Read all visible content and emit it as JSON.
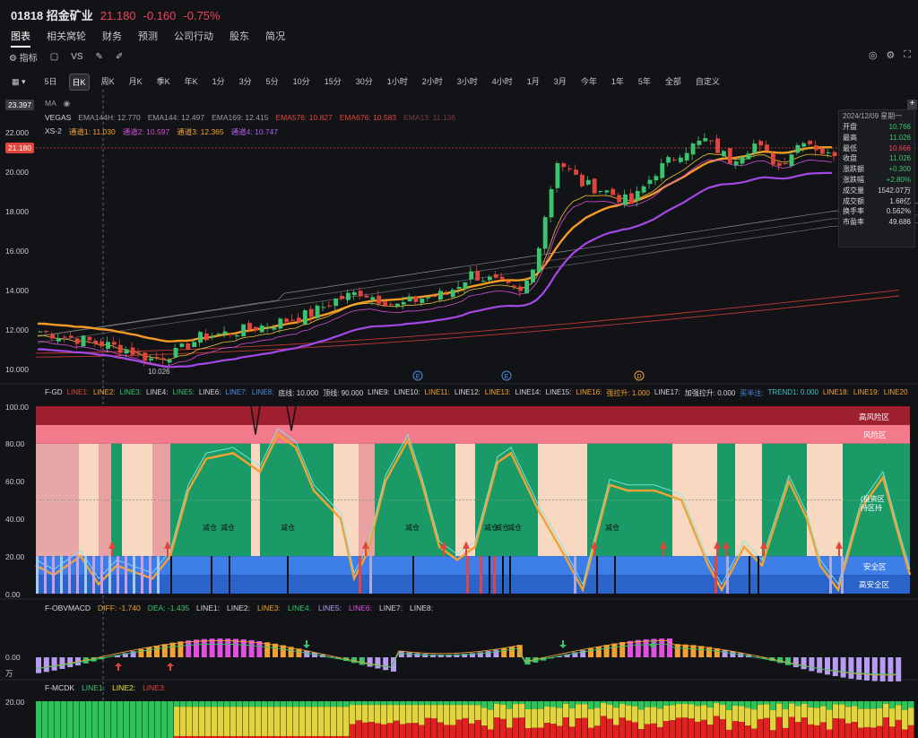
{
  "header": {
    "code": "01818 招金矿业",
    "price": "21.180",
    "change": "-0.160",
    "change_pct": "-0.75%"
  },
  "nav": [
    "图表",
    "相关窝轮",
    "财务",
    "预测",
    "公司行动",
    "股东",
    "简况"
  ],
  "tools": {
    "indicator": "指标",
    "vs": "VS"
  },
  "timeframes": [
    "5日",
    "日K",
    "周K",
    "月K",
    "季K",
    "年K",
    "1分",
    "3分",
    "5分",
    "10分",
    "15分",
    "30分",
    "1小时",
    "2小时",
    "3小时",
    "4小时",
    "1月",
    "3月",
    "今年",
    "1年",
    "5年",
    "全部",
    "自定义"
  ],
  "ma_label": "MA",
  "main_legend": {
    "row1": [
      {
        "t": "VEGAS",
        "c": "#d6d7da"
      },
      {
        "t": "EMA144H: 12.770",
        "c": "#9a9ba0"
      },
      {
        "t": "EMA144: 12.497",
        "c": "#9a9ba0"
      },
      {
        "t": "EMA169: 12.415",
        "c": "#9a9ba0"
      },
      {
        "t": "EMA576: 10.827",
        "c": "#e2453c"
      },
      {
        "t": "EMA676: 10.583",
        "c": "#e2453c"
      },
      {
        "t": "EMA13: 11.136",
        "c": "#7a3a3a"
      }
    ],
    "row2": [
      {
        "t": "XS-2",
        "c": "#d6d7da"
      },
      {
        "t": "通道1: 11.030",
        "c": "#f2a233"
      },
      {
        "t": "通道2: 10.597",
        "c": "#d14fd6"
      },
      {
        "t": "通道3: 12.365",
        "c": "#f2a233"
      },
      {
        "t": "通道4: 10.747",
        "c": "#b45cf0"
      }
    ]
  },
  "price_axis": [
    "22.000",
    "20.000",
    "18.000",
    "16.000",
    "14.000",
    "12.000",
    "10.000"
  ],
  "top_price": "23.397",
  "current_price": "21.180",
  "low_label": "10.026",
  "event_markers": [
    "E",
    "E",
    "D"
  ],
  "info": {
    "date": "2024/12/09 星期一",
    "rows": [
      {
        "k": "开盘",
        "v": "10.766",
        "c": "#3bc46f"
      },
      {
        "k": "最高",
        "v": "11.026",
        "c": "#3bc46f"
      },
      {
        "k": "最低",
        "v": "10.666",
        "c": "#f0445a"
      },
      {
        "k": "收盘",
        "v": "11.026",
        "c": "#3bc46f"
      },
      {
        "k": "涨跌额",
        "v": "+0.300",
        "c": "#3bc46f"
      },
      {
        "k": "涨跌幅",
        "v": "+2.80%",
        "c": "#3bc46f"
      },
      {
        "k": "成交量",
        "v": "1542.07万",
        "c": "#d6d7da"
      },
      {
        "k": "成交额",
        "v": "1.68亿",
        "c": "#d6d7da"
      },
      {
        "k": "换手率",
        "v": "0.562%",
        "c": "#d6d7da"
      },
      {
        "k": "市盈率",
        "v": "49.686",
        "c": "#d6d7da"
      }
    ]
  },
  "fgd": {
    "legend": [
      {
        "t": "F-GD",
        "c": "#d6d7da"
      },
      {
        "t": "LINE1:",
        "c": "#e2453c"
      },
      {
        "t": "LINE2:",
        "c": "#f2a233"
      },
      {
        "t": "LINE3:",
        "c": "#3bc46f"
      },
      {
        "t": "LINE4:",
        "c": "#d6d7da"
      },
      {
        "t": "LINE5:",
        "c": "#3bc46f"
      },
      {
        "t": "LINE6:",
        "c": "#d6d7da"
      },
      {
        "t": "LINE7:",
        "c": "#4a90e2"
      },
      {
        "t": "LINE8:",
        "c": "#4a90e2"
      },
      {
        "t": "底线: 10.000",
        "c": "#d6d7da"
      },
      {
        "t": "顶线: 90.000",
        "c": "#d6d7da"
      },
      {
        "t": "LINE9:",
        "c": "#d6d7da"
      },
      {
        "t": "LINE10:",
        "c": "#d6d7da"
      },
      {
        "t": "LINE11:",
        "c": "#f2a233"
      },
      {
        "t": "LINE12:",
        "c": "#d6d7da"
      },
      {
        "t": "LINE13:",
        "c": "#f2a233"
      },
      {
        "t": "LINE14:",
        "c": "#d6d7da"
      },
      {
        "t": "LINE15:",
        "c": "#d6d7da"
      },
      {
        "t": "LINE16:",
        "c": "#f2a233"
      },
      {
        "t": "强拉升: 1.000",
        "c": "#f2a233"
      },
      {
        "t": "LINE17:",
        "c": "#d6d7da"
      },
      {
        "t": "加强拉升: 0.000",
        "c": "#d6d7da"
      },
      {
        "t": "买半注:",
        "c": "#4a90e2"
      },
      {
        "t": "TREND1: 0.000",
        "c": "#3bc4c4"
      },
      {
        "t": "LINE18:",
        "c": "#f2a233"
      },
      {
        "t": "LINE19:",
        "c": "#f2a233"
      },
      {
        "t": "LINE20",
        "c": "#f2a233"
      }
    ],
    "axis": [
      "100.00",
      "80.00",
      "60.00",
      "40.00",
      "20.00",
      "0.00"
    ],
    "zones": {
      "high_risk": "高风险区",
      "risk": "风险区",
      "safe": "安全区",
      "high_safe": "高安全区"
    },
    "reduce": [
      "减仓",
      "减仓",
      "减仓",
      "减仓",
      "减仓",
      "减仓",
      "减仓",
      "减仓"
    ],
    "invest": [
      "(投资区",
      "持区持"
    ]
  },
  "obv": {
    "legend": [
      {
        "t": "F-OBVMACD",
        "c": "#d6d7da"
      },
      {
        "t": "DIFF: -1.740",
        "c": "#f2a233"
      },
      {
        "t": "DEA: -1.435",
        "c": "#3bc46f"
      },
      {
        "t": "LINE1:",
        "c": "#d6d7da"
      },
      {
        "t": "LINE2:",
        "c": "#d6d7da"
      },
      {
        "t": "LINE3:",
        "c": "#f2a233"
      },
      {
        "t": "LINE4:",
        "c": "#3bc46f"
      },
      {
        "t": "LINE5:",
        "c": "#b79cf2"
      },
      {
        "t": "LINE6:",
        "c": "#e24fe0"
      },
      {
        "t": "LINE7:",
        "c": "#d6d7da"
      },
      {
        "t": "LINE8:",
        "c": "#d6d7da"
      }
    ],
    "axis": [
      "0.00",
      "万"
    ]
  },
  "mcdk": {
    "legend": [
      {
        "t": "F-MCDK",
        "c": "#d6d7da"
      },
      {
        "t": "LINE1:",
        "c": "#3bc46f"
      },
      {
        "t": "LINE2:",
        "c": "#f2e233"
      },
      {
        "t": "LINE3:",
        "c": "#e2453c"
      }
    ],
    "axis": [
      "20.00"
    ]
  }
}
